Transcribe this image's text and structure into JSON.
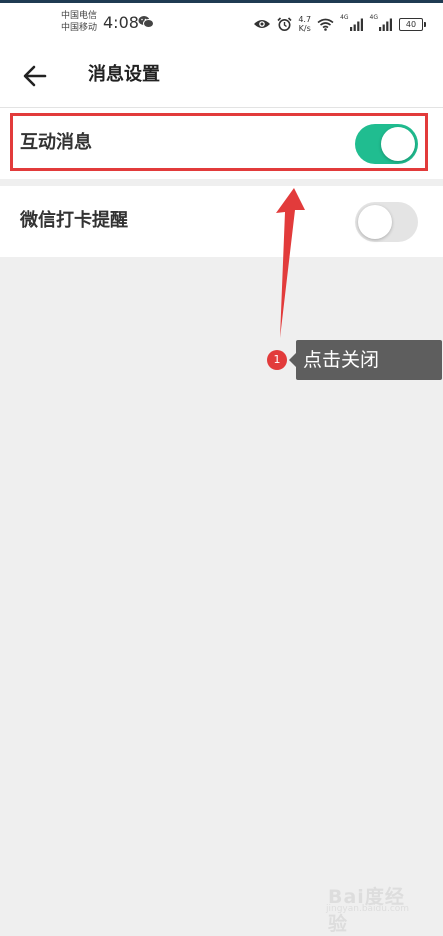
{
  "status_bar": {
    "carrier_1": "中国电信",
    "carrier_2": "中国移动",
    "time": "4:08",
    "speed_value": "4.7",
    "speed_unit": "K/s",
    "network_1": "4G",
    "network_2": "4G",
    "battery": "40"
  },
  "header": {
    "back_icon": "arrow-left-icon",
    "title": "消息设置"
  },
  "settings": [
    {
      "label": "互动消息",
      "enabled": true
    },
    {
      "label": "微信打卡提醒",
      "enabled": false
    }
  ],
  "annotation": {
    "step_number": "1",
    "text": "点击关闭",
    "color": "#e23b3b"
  },
  "colors": {
    "toggle_on": "#20bd90",
    "toggle_off": "#e4e4e4",
    "background": "#efefef"
  },
  "watermark": {
    "logo": "Bai度经验",
    "sub": "jingyan.baidu.com"
  }
}
